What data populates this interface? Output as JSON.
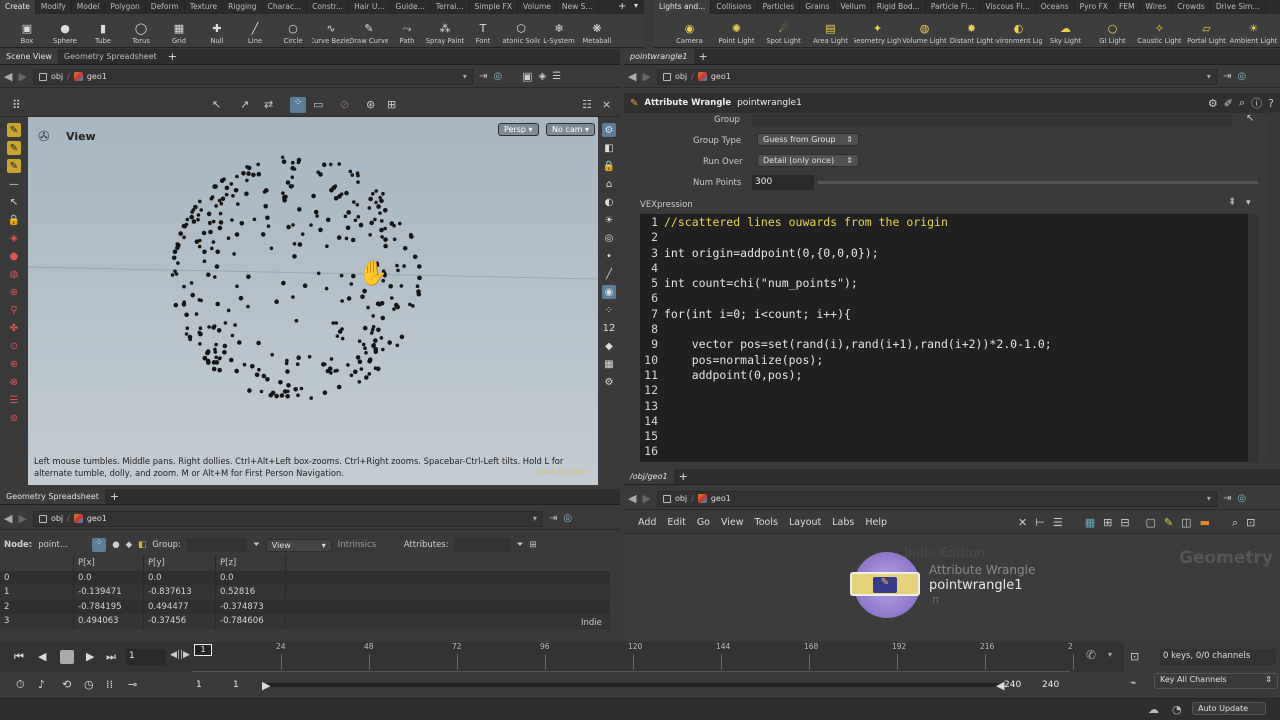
{
  "shelf_left_tabs": [
    "Create",
    "Modify",
    "Model",
    "Polygon",
    "Deform",
    "Texture",
    "Rigging",
    "Charac...",
    "Constr...",
    "Hair U...",
    "Guide...",
    "Terrai...",
    "Simple FX",
    "Volume",
    "New S..."
  ],
  "shelf_left_tools": [
    {
      "label": "Box",
      "icon": "box-icon"
    },
    {
      "label": "Sphere",
      "icon": "sphere-icon"
    },
    {
      "label": "Tube",
      "icon": "tube-icon"
    },
    {
      "label": "Torus",
      "icon": "torus-icon"
    },
    {
      "label": "Grid",
      "icon": "grid-icon"
    },
    {
      "label": "Null",
      "icon": "null-icon"
    },
    {
      "label": "Line",
      "icon": "line-icon"
    },
    {
      "label": "Circle",
      "icon": "circle-icon"
    },
    {
      "label": "Curve Bezier",
      "icon": "curve-bezier-icon"
    },
    {
      "label": "Draw Curve",
      "icon": "draw-curve-icon"
    },
    {
      "label": "Path",
      "icon": "path-icon"
    },
    {
      "label": "Spray Paint",
      "icon": "spray-paint-icon"
    },
    {
      "label": "Font",
      "icon": "font-icon"
    },
    {
      "label": "Platonic Solids",
      "icon": "platonic-icon"
    },
    {
      "label": "L-System",
      "icon": "lsystem-icon"
    },
    {
      "label": "Metaball",
      "icon": "metaball-icon"
    }
  ],
  "shelf_right_tabs": [
    "Lights and...",
    "Collisions",
    "Particles",
    "Grains",
    "Vellum",
    "Rigid Bod...",
    "Particle Fl...",
    "Viscous Fl...",
    "Oceans",
    "Pyro FX",
    "FEM",
    "Wires",
    "Crowds",
    "Drive Sim..."
  ],
  "shelf_right_tools": [
    {
      "label": "Camera",
      "icon": "camera-icon"
    },
    {
      "label": "Point Light",
      "icon": "point-light-icon"
    },
    {
      "label": "Spot Light",
      "icon": "spot-light-icon"
    },
    {
      "label": "Area Light",
      "icon": "area-light-icon"
    },
    {
      "label": "Geometry Light",
      "icon": "geometry-light-icon"
    },
    {
      "label": "Volume Light",
      "icon": "volume-light-icon"
    },
    {
      "label": "Distant Light",
      "icon": "distant-light-icon"
    },
    {
      "label": "Environment Light",
      "icon": "environment-light-icon"
    },
    {
      "label": "Sky Light",
      "icon": "sky-light-icon"
    },
    {
      "label": "GI Light",
      "icon": "gi-light-icon"
    },
    {
      "label": "Caustic Light",
      "icon": "caustic-light-icon"
    },
    {
      "label": "Portal Light",
      "icon": "portal-light-icon"
    },
    {
      "label": "Ambient Light",
      "icon": "ambient-light-icon"
    }
  ],
  "left_tabs": {
    "scene_view": "Scene View",
    "geo_sheet": "Geometry Spreadsheet"
  },
  "path": {
    "obj": "obj",
    "geo": "geo1"
  },
  "viewport": {
    "title": "View",
    "persp": "Persp",
    "cam": "No cam",
    "hint": "Left mouse tumbles. Middle pans. Right dollies. Ctrl+Alt+Left box-zooms. Ctrl+Right zooms. Spacebar-Ctrl-Left tilts. Hold L for alternate tumble, dolly, and zoom. M or Alt+M for First Person Navigation.",
    "watermark": "Indie Edition"
  },
  "sheet": {
    "tab": "Geometry Spreadsheet",
    "node_label": "Node:",
    "node": "point...",
    "group_label": "Group:",
    "view": "View",
    "intrinsics": "Intrinsics",
    "attributes": "Attributes:",
    "indie": "Indie",
    "headers": [
      "",
      "P[x]",
      "P[y]",
      "P[z]"
    ],
    "rows": [
      [
        "0",
        "0.0",
        "0.0",
        "0.0"
      ],
      [
        "1",
        "-0.139471",
        "-0.837613",
        "0.52816"
      ],
      [
        "2",
        "-0.784195",
        "0.494477",
        "-0.374873"
      ],
      [
        "3",
        "0.494063",
        "-0.37456",
        "-0.784606"
      ]
    ]
  },
  "params": {
    "tab": "pointwrangle1",
    "title_type": "Attribute Wrangle",
    "title_name": "pointwrangle1",
    "group": "Group",
    "group_type_label": "Group Type",
    "group_type": "Guess from Group",
    "run_over_label": "Run Over",
    "run_over": "Detail (only once)",
    "num_points_label": "Num Points",
    "num_points": "300",
    "num_points_fraction": 0.0,
    "vex_label": "VEXpression"
  },
  "code": [
    {
      "n": "1",
      "t": "//scattered lines ouwards from the origin",
      "c": "#e8d44d"
    },
    {
      "n": "2",
      "t": "",
      "c": "#e6e6e6"
    },
    {
      "n": "3",
      "t": "int origin=addpoint(0,{0,0,0});",
      "c": "#e6e6e6"
    },
    {
      "n": "4",
      "t": "",
      "c": "#e6e6e6"
    },
    {
      "n": "5",
      "t": "int count=chi(\"num_points\");",
      "c": "#e6e6e6"
    },
    {
      "n": "6",
      "t": "",
      "c": "#e6e6e6"
    },
    {
      "n": "7",
      "t": "for(int i=0; i<count; i++){",
      "c": "#e6e6e6"
    },
    {
      "n": "8",
      "t": "",
      "c": "#e6e6e6"
    },
    {
      "n": "9",
      "t": "    vector pos=set(rand(i),rand(i+1),rand(i+2))*2.0-1.0;",
      "c": "#e6e6e6"
    },
    {
      "n": "10",
      "t": "    pos=normalize(pos);",
      "c": "#e6e6e6"
    },
    {
      "n": "11",
      "t": "    addpoint(0,pos);",
      "c": "#e6e6e6"
    },
    {
      "n": "12",
      "t": "",
      "c": "#e6e6e6"
    },
    {
      "n": "13",
      "t": "",
      "c": "#e6e6e6"
    },
    {
      "n": "14",
      "t": "",
      "c": "#e6e6e6"
    },
    {
      "n": "15",
      "t": "",
      "c": "#e6e6e6"
    },
    {
      "n": "16",
      "t": "",
      "c": "#e6e6e6"
    }
  ],
  "network": {
    "tab": "/obj/geo1",
    "menu": [
      "Add",
      "Edit",
      "Go",
      "View",
      "Tools",
      "Layout",
      "Labs",
      "Help"
    ],
    "watermark": "Indie Edition",
    "context": "Geometry",
    "node_type": "Attribute Wrangle",
    "node_name": "pointwrangle1"
  },
  "timeline": {
    "frame": "1",
    "ticks": [
      "24",
      "48",
      "72",
      "96",
      "120",
      "144",
      "168",
      "192",
      "216",
      "2"
    ],
    "start": "1",
    "start2": "1",
    "end": "240",
    "end2": "240",
    "keys": "0 keys, 0/0 channels",
    "key_all": "Key All Channels",
    "auto_update": "Auto Update"
  }
}
